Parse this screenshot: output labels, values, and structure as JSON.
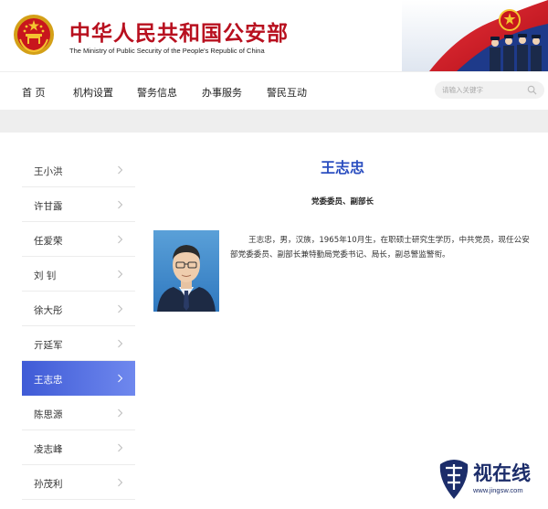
{
  "header": {
    "title": "中华人民共和国公安部",
    "subtitle": "The Ministry of Public Security of the People's Republic of China"
  },
  "nav": {
    "items": [
      "首 页",
      "机构设置",
      "警务信息",
      "办事服务",
      "警民互动"
    ]
  },
  "search": {
    "placeholder": "请输入关键字"
  },
  "sidebar": {
    "items": [
      "王小洪",
      "许甘露",
      "任爱荣",
      "刘 钊",
      "徐大彤",
      "亓延军",
      "王志忠",
      "陈思源",
      "凌志峰",
      "孙茂利"
    ],
    "active_index": 6
  },
  "profile": {
    "name": "王志忠",
    "title": "党委委员、副部长",
    "bio": "王志忠，男，汉族，1965年10月生，在职硕士研究生学历，中共党员，现任公安部党委委员、副部长兼特勤局党委书记、局长，副总警监警衔。"
  },
  "watermark": {
    "text": "视在线",
    "url": "www.jingsw.com"
  },
  "colors": {
    "brand_red": "#b8101f",
    "accent_blue": "#2c4fc0",
    "active_gradient_start": "#3f5bd6",
    "active_gradient_end": "#6f88ee"
  }
}
